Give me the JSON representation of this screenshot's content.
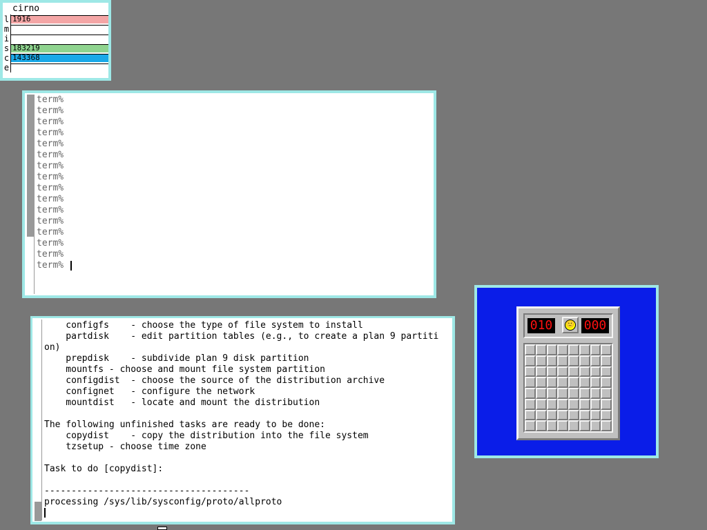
{
  "stats": {
    "hostname": "cirno",
    "rows": [
      {
        "label": "l",
        "value": "1916",
        "color": "#f4a6a6"
      },
      {
        "label": "m",
        "value": "",
        "color": "#ffffff"
      },
      {
        "label": "i",
        "value": "",
        "color": "#ffffff"
      },
      {
        "label": "s",
        "value": "183219",
        "color": "#8fd48f"
      },
      {
        "label": "c",
        "value": "143368",
        "color": "#1aa9e8"
      },
      {
        "label": "e",
        "value": "",
        "color": "#ffffff"
      }
    ]
  },
  "terminal_top": {
    "prompt": "term%",
    "lines": [
      "term%",
      "term%",
      "term%",
      "term%",
      "term%",
      "term%",
      "term%",
      "term%",
      "term%",
      "term%",
      "term%",
      "term%",
      "term%",
      "term%",
      "term%",
      "term%"
    ]
  },
  "terminal_bottom": {
    "lines": [
      "    configfs    - choose the type of file system to install",
      "    partdisk    - edit partition tables (e.g., to create a plan 9 partiti",
      "on)",
      "    prepdisk    - subdivide plan 9 disk partition",
      "    mountfs - choose and mount file system partition",
      "    configdist  - choose the source of the distribution archive",
      "    confignet   - configure the network",
      "    mountdist   - locate and mount the distribution",
      "",
      "The following unfinished tasks are ready to be done:",
      "    copydist    - copy the distribution into the file system",
      "    tzsetup - choose time zone",
      "",
      "Task to do [copydist]:",
      "",
      "--------------------------------------",
      "processing /sys/lib/sysconfig/proto/allproto"
    ]
  },
  "minesweeper": {
    "mines_left": "010",
    "timer": "000",
    "smiley": "🙂",
    "rows": 8,
    "cols": 8
  },
  "colors": {
    "desktop": "#777777",
    "window_border": "#9ee8e6",
    "mines_bg": "#0a1de8"
  }
}
